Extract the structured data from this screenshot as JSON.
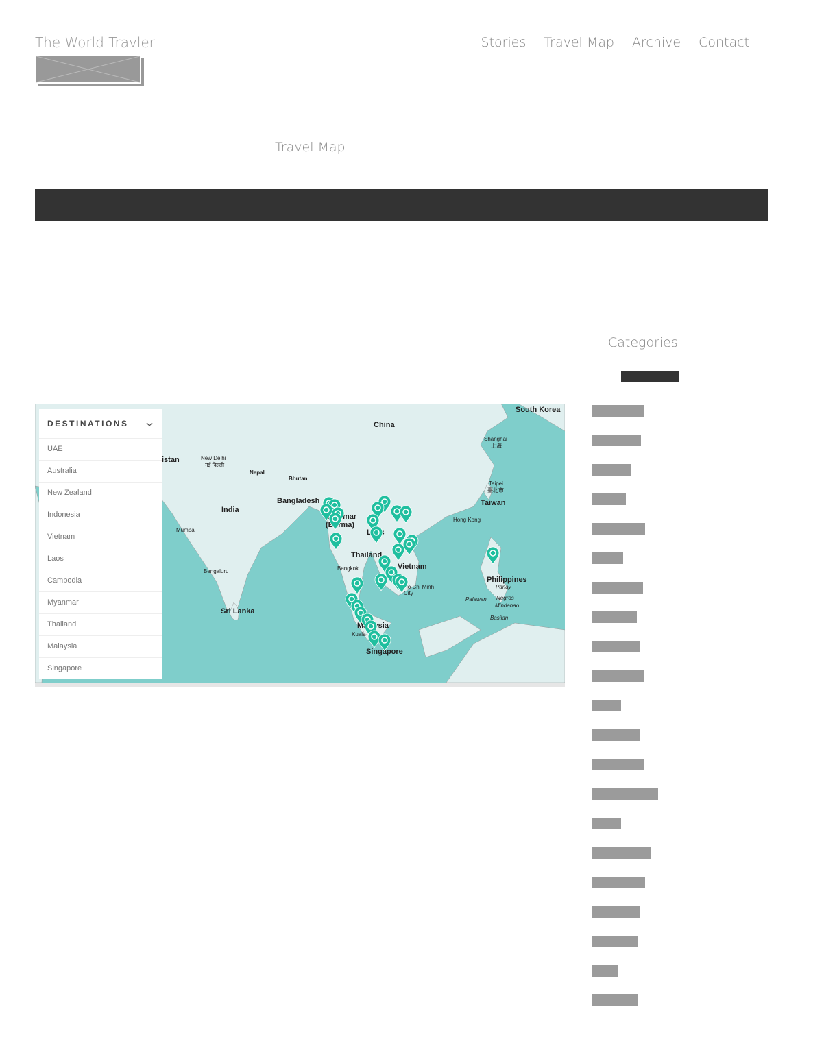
{
  "site": {
    "title": "The World Travler"
  },
  "nav": [
    "Stories",
    "Travel Map",
    "Archive",
    "Contact"
  ],
  "page": {
    "title": "Travel Map"
  },
  "sidebar": {
    "title": "Categories",
    "bar_widths_pct": [
      77,
      72,
      58,
      50,
      78,
      46,
      75,
      66,
      70,
      77,
      43,
      70,
      76,
      97,
      43,
      86,
      78,
      70,
      68,
      39,
      67
    ]
  },
  "map": {
    "colors": {
      "sea": "#7fcecb",
      "land": "#e0efef",
      "marker": "#1fbf9f"
    },
    "destinations_header": "DESTINATIONS",
    "destinations": [
      "UAE",
      "Australia",
      "New Zealand",
      "Indonesia",
      "Vietnam",
      "Laos",
      "Cambodia",
      "Myanmar",
      "Thailand",
      "Malaysia",
      "Singapore"
    ],
    "labels": {
      "china": "China",
      "south_korea": "South Korea",
      "shanghai": "Shanghai",
      "shanghai_cn": "上海",
      "pakistan": "istan",
      "new_delhi": "New Delhi",
      "new_delhi_hi": "नई दिल्ली",
      "nepal": "Nepal",
      "bhutan": "Bhutan",
      "bangladesh": "Bangladesh",
      "india": "India",
      "myanmar": "Myanmar (Burma)",
      "laos": "Laos",
      "taipei": "Taipei",
      "taipei_cn": "臺北市",
      "taiwan": "Taiwan",
      "hong_kong": "Hong Kong",
      "mumbai": "Mumbai",
      "thailand": "Thailand",
      "bangkok": "Bangkok",
      "vietnam": "Vietnam",
      "philippines": "Philippines",
      "bengaluru": "Bengaluru",
      "ho_chi_minh": "Ho Chi Minh City",
      "panay": "Panay",
      "palawan": "Palawan",
      "negros": "Negros",
      "mindanao": "Mindanao",
      "basilan": "Basilan",
      "sri_lanka": "Sri Lanka",
      "malaysia": "Malaysia",
      "kuala": "Kuala",
      "singapore": "Singapore"
    }
  }
}
